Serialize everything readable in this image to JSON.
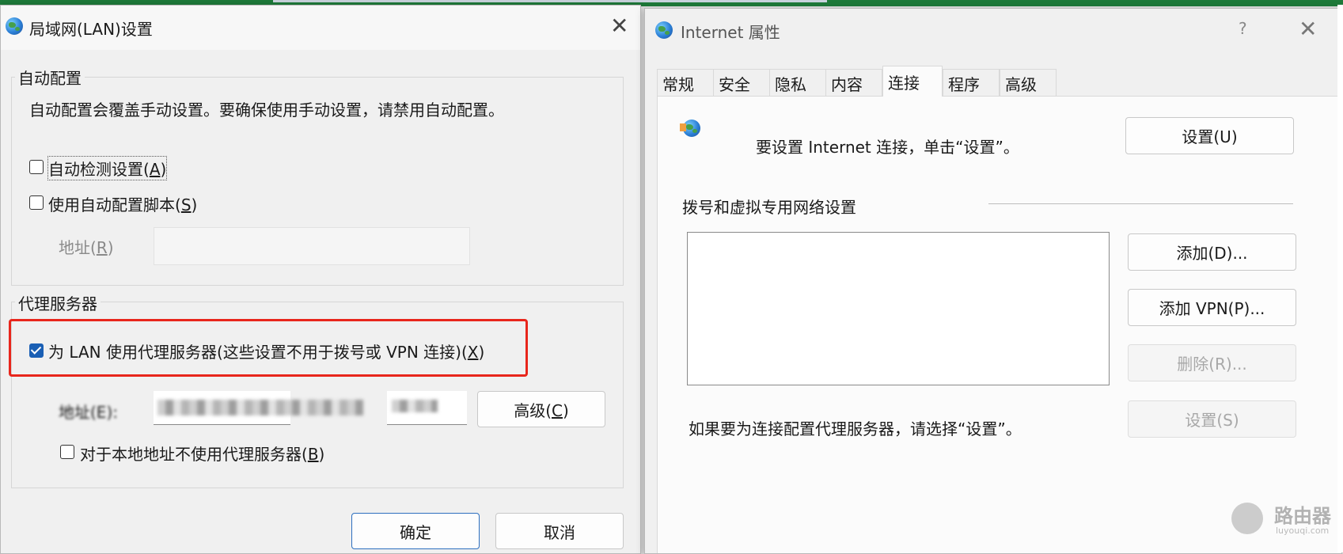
{
  "lan_dialog": {
    "title": "局域网(LAN)设置",
    "auto_config": {
      "group_title": "自动配置",
      "description": "自动配置会覆盖手动设置。要确保使用手动设置，请禁用自动配置。",
      "auto_detect_label": "自动检测设置(A)",
      "auto_detect_checked": false,
      "auto_script_label": "使用自动配置脚本(S)",
      "auto_script_checked": false,
      "address_label": "地址(R)"
    },
    "proxy": {
      "group_title": "代理服务器",
      "use_proxy_label": "为 LAN 使用代理服务器(这些设置不用于拨号或 VPN 连接)(X)",
      "use_proxy_checked": true,
      "address_label": "地址(E):",
      "advanced_button": "高级(C)",
      "bypass_local_label": "对于本地地址不使用代理服务器(B)",
      "bypass_local_checked": false
    },
    "ok_button": "确定",
    "cancel_button": "取消"
  },
  "internet_props": {
    "title": "Internet 属性",
    "help_glyph": "?",
    "tabs": [
      "常规",
      "安全",
      "隐私",
      "内容",
      "连接",
      "程序",
      "高级"
    ],
    "active_tab": "连接",
    "setup_text": "要设置 Internet 连接，单击“设置”。",
    "setup_button": "设置(U)",
    "dialup_section_title": "拨号和虚拟专用网络设置",
    "add_button": "添加(D)...",
    "add_vpn_button": "添加 VPN(P)...",
    "remove_button": "删除(R)...",
    "settings_button": "设置(S)",
    "proxy_hint": "如果要为连接配置代理服务器，请选择“设置”。"
  },
  "watermark": {
    "text": "路由器",
    "subtext": "luyouqi.com"
  },
  "colors": {
    "highlight_red": "#e8261c",
    "checkbox_blue": "#1a5fb4",
    "top_stripe_green": "#1e7a3a"
  }
}
